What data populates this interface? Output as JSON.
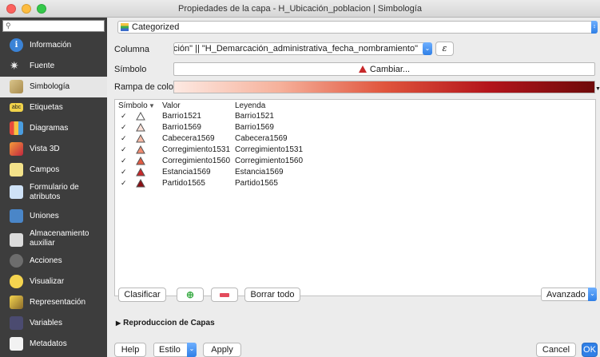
{
  "window": {
    "title": "Propiedades de la capa - H_Ubicación_poblacion | Simbología"
  },
  "sidebar": {
    "items": [
      {
        "label": "Información",
        "icon": "info-icon"
      },
      {
        "label": "Fuente",
        "icon": "source-icon"
      },
      {
        "label": "Simbología",
        "icon": "brush-icon",
        "active": true
      },
      {
        "label": "Etiquetas",
        "icon": "labels-icon"
      },
      {
        "label": "Diagramas",
        "icon": "diagram-icon"
      },
      {
        "label": "Vista 3D",
        "icon": "cube-icon"
      },
      {
        "label": "Campos",
        "icon": "fields-icon"
      },
      {
        "label": "Formulario de",
        "label2": "atributos",
        "icon": "form-icon"
      },
      {
        "label": "Uniones",
        "icon": "joins-icon"
      },
      {
        "label": "Almacenamiento",
        "label2": "auxiliar",
        "icon": "storage-icon"
      },
      {
        "label": "Acciones",
        "icon": "actions-icon"
      },
      {
        "label": "Visualizar",
        "icon": "display-icon"
      },
      {
        "label": "Representación",
        "icon": "rendering-icon"
      },
      {
        "label": "Variables",
        "icon": "variables-icon"
      },
      {
        "label": "Metadatos",
        "icon": "metadata-icon"
      }
    ]
  },
  "renderer": {
    "type": "Categorized"
  },
  "column": {
    "label": "Columna",
    "value": "Demarcación\" || \"H_Demarcación_administrativa_fecha_nombramiento\""
  },
  "symbol": {
    "label": "Símbolo",
    "button": "Cambiar..."
  },
  "ramp": {
    "label": "Rampa de color"
  },
  "table": {
    "headers": {
      "symbol": "Símbolo",
      "value": "Valor",
      "legend": "Leyenda"
    },
    "rows": [
      {
        "value": "Barrio1521",
        "legend": "Barrio1521",
        "color": "#ffffff"
      },
      {
        "value": "Barrio1569",
        "legend": "Barrio1569",
        "color": "#fbe1d8"
      },
      {
        "value": "Cabecera1569",
        "legend": "Cabecera1569",
        "color": "#f6b9a5"
      },
      {
        "value": "Corregimiento1531",
        "legend": "Corregimiento1531",
        "color": "#ee8a70"
      },
      {
        "value": "Corregimiento1560",
        "legend": "Corregimiento1560",
        "color": "#e15a42"
      },
      {
        "value": "Estancia1569",
        "legend": "Estancia1569",
        "color": "#c7282a"
      },
      {
        "value": "Partido1565",
        "legend": "Partido1565",
        "color": "#8b0f14"
      }
    ]
  },
  "buttons": {
    "classify": "Clasificar",
    "delete_all": "Borrar todo",
    "advanced": "Avanzado",
    "help": "Help",
    "style": "Estilo",
    "apply": "Apply",
    "cancel": "Cancel",
    "ok": "OK"
  },
  "layer_rendering": {
    "label": "Reproduccion de Capas"
  },
  "colors": {
    "accent": "#2f7fe6",
    "sidebar": "#3d3d3d"
  }
}
